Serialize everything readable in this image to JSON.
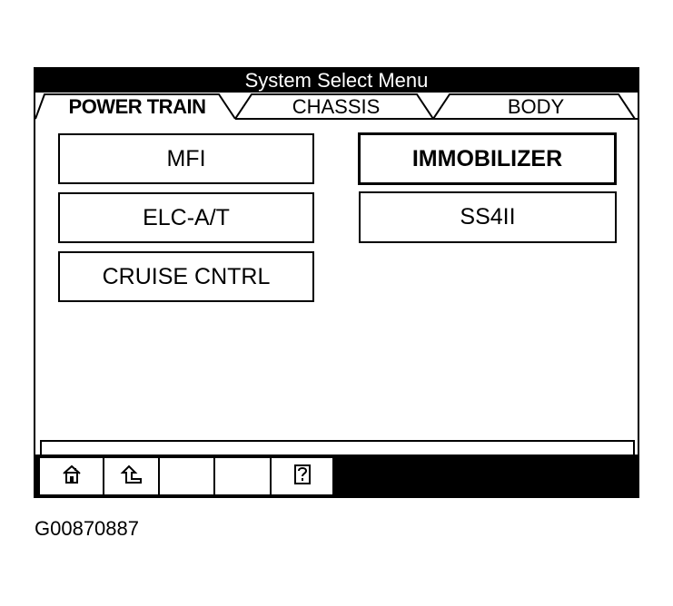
{
  "window": {
    "title": "System Select Menu"
  },
  "tabs": [
    {
      "label": "POWER TRAIN",
      "active": true
    },
    {
      "label": "CHASSIS",
      "active": false
    },
    {
      "label": "BODY",
      "active": false
    }
  ],
  "systems": {
    "mfi": "MFI",
    "immobilizer": "IMMOBILIZER",
    "elc_at": "ELC-A/T",
    "ss4ii": "SS4II",
    "cruise": "CRUISE CNTRL",
    "selected": "IMMOBILIZER"
  },
  "function_keys": [
    {
      "icon": "home-icon"
    },
    {
      "icon": "return-arrow-icon"
    },
    {
      "icon": "blank"
    },
    {
      "icon": "blank"
    },
    {
      "icon": "help-icon"
    }
  ],
  "caption": "G00870887",
  "colors": {
    "background": "#ffffff",
    "foreground": "#000000"
  }
}
